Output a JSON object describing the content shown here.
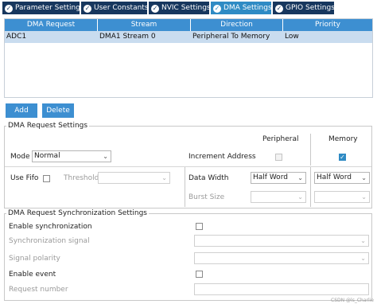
{
  "tabs": [
    {
      "label": "Parameter Settings",
      "active": false
    },
    {
      "label": "User Constants",
      "active": false
    },
    {
      "label": "NVIC Settings",
      "active": false
    },
    {
      "label": "DMA Settings",
      "active": true
    },
    {
      "label": "GPIO Settings",
      "active": false
    }
  ],
  "table": {
    "headers": [
      "DMA Request",
      "Stream",
      "Direction",
      "Priority"
    ],
    "rows": [
      [
        "ADC1",
        "DMA1 Stream 0",
        "Peripheral To Memory",
        "Low"
      ]
    ]
  },
  "buttons": {
    "add": "Add",
    "delete": "Delete"
  },
  "dma_settings": {
    "title": "DMA Request Settings",
    "peripheral_header": "Peripheral",
    "memory_header": "Memory",
    "mode_label": "Mode",
    "mode_value": "Normal",
    "increment_label": "Increment Address",
    "peripheral_increment": false,
    "memory_increment": true,
    "use_fifo_label": "Use Fifo",
    "use_fifo": false,
    "threshold_label": "Threshold",
    "threshold_value": "",
    "data_width_label": "Data Width",
    "peripheral_data_width": "Half Word",
    "memory_data_width": "Half Word",
    "burst_size_label": "Burst Size",
    "peripheral_burst": "",
    "memory_burst": ""
  },
  "sync_settings": {
    "title": "DMA Request Synchronization Settings",
    "enable_sync_label": "Enable synchronization",
    "enable_sync": false,
    "sync_signal_label": "Synchronization signal",
    "sync_signal_value": "",
    "signal_polarity_label": "Signal polarity",
    "signal_polarity_value": "",
    "enable_event_label": "Enable event",
    "enable_event": false,
    "request_number_label": "Request number",
    "request_number_value": ""
  },
  "watermark": "CSDN @ls_Charlie",
  "colors": {
    "tab": "#17375e",
    "tab_active": "#2f8bc4",
    "header": "#3d8fd1",
    "row_selected": "#c9dcef"
  },
  "icons": {
    "tab_check": "check-circle-icon",
    "dropdown": "chevron-down-icon",
    "checkbox_checked": "check-icon"
  }
}
